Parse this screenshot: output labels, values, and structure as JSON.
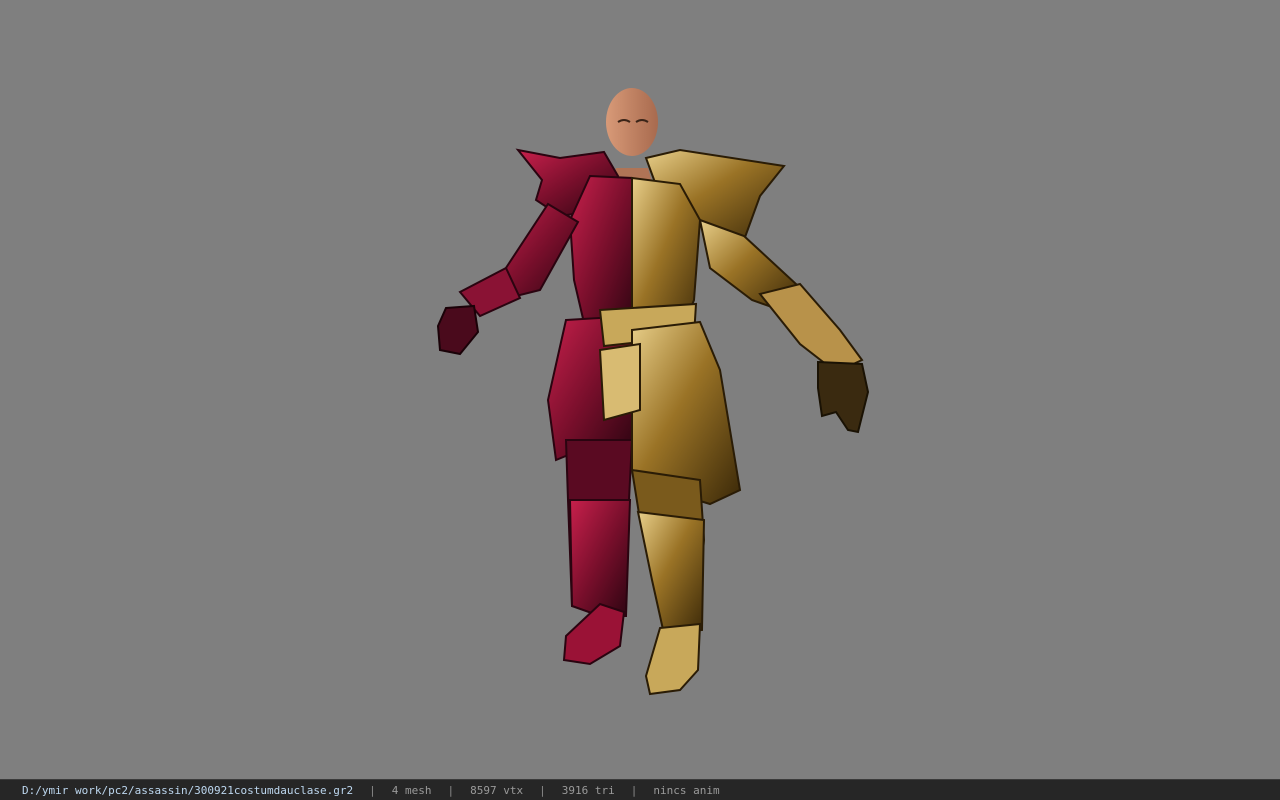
{
  "viewport": {
    "background": "#7f7f7f",
    "model_name": "assassin costume (red / gold half armor)"
  },
  "colors": {
    "red_armor": "#a0183c",
    "red_dark": "#3a0616",
    "gold_armor": "#a07a2a",
    "gold_dark": "#3a2808",
    "skin": "#c58a68"
  },
  "status_bar": {
    "file_path": "D:/ymir work/pc2/assassin/300921costumdauclase.gr2",
    "separator": "|",
    "mesh_count": "4 mesh",
    "vertex_count": "8597 vtx",
    "triangle_count": "3916 tri",
    "anim_status": "nincs anim"
  }
}
